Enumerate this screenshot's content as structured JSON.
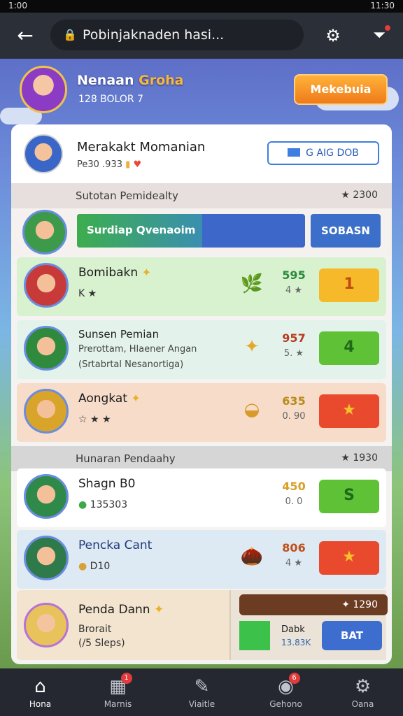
{
  "status_bar": {
    "time_left": "1:00",
    "time_right": "11:30"
  },
  "top_bar": {
    "url": "Pobinjaknaden hasi..."
  },
  "header": {
    "name_part1": "Nenaan",
    "name_part2": "Groha",
    "subtitle": "128 BOLOR 7",
    "button_label": "Mekebuia"
  },
  "profile": {
    "name": "Merakakt Momanian",
    "stats": "Pe30 .933",
    "button_label": "G AIG DOB"
  },
  "section1": {
    "title": "Sutotan Pemidealty",
    "score": "★ 2300"
  },
  "progress": {
    "label": "Surdiap Qvenaoim",
    "fill_fraction": 0.55,
    "button_label": "SOBASN"
  },
  "rows": [
    {
      "name": "Bomibakn",
      "meta": "K ★",
      "item_icon": "🌿",
      "points": "595",
      "points_sub": "4 ★",
      "action_label": "1",
      "action_color": "#f5b92a"
    },
    {
      "name": "Sunsen Pemian",
      "line2": "Prerottam, Hlaener Angan",
      "line3": "(Srtabrtal Nesanortiga)",
      "item_icon": "✦",
      "points": "957",
      "points_sub": "5. ★",
      "action_label": "4",
      "action_color": "#5fc236"
    },
    {
      "name": "Aongkat",
      "meta": "☆ ★ ★",
      "item_icon": "◒",
      "points": "635",
      "points_sub": "0. 90",
      "action_label": "★",
      "action_color": "#e94a2e"
    }
  ],
  "section2": {
    "title": "Hunaran Pendaahy",
    "score": "★ 1930"
  },
  "rows2": [
    {
      "name": "Shagn B0",
      "meta": "135303",
      "item_icon": "",
      "points": "450",
      "points_sub": "0. 0",
      "action_label": "S",
      "action_color": "#5fc236"
    },
    {
      "name": "Pencka Cant",
      "meta": "D10",
      "item_icon": "🌰",
      "points": "806",
      "points_sub": "4 ★",
      "action_label": "★",
      "action_color": "#e94a2e"
    }
  ],
  "bottom_entry": {
    "name": "Penda Dann",
    "line2": "Brorait",
    "line3": "(/5 Sleps)",
    "card_header": "✦ 1290",
    "card_label": "Dabk",
    "card_sub": "13.83K",
    "card_button": "BAT"
  },
  "nav": [
    {
      "label": "Hona",
      "icon": "home-icon",
      "badge": ""
    },
    {
      "label": "Marnis",
      "icon": "map-icon",
      "badge": "1"
    },
    {
      "label": "Viaitle",
      "icon": "pen-icon",
      "badge": ""
    },
    {
      "label": "Gehono",
      "icon": "controller-icon",
      "badge": "6"
    },
    {
      "label": "Oana",
      "icon": "gear-icon",
      "badge": ""
    }
  ]
}
